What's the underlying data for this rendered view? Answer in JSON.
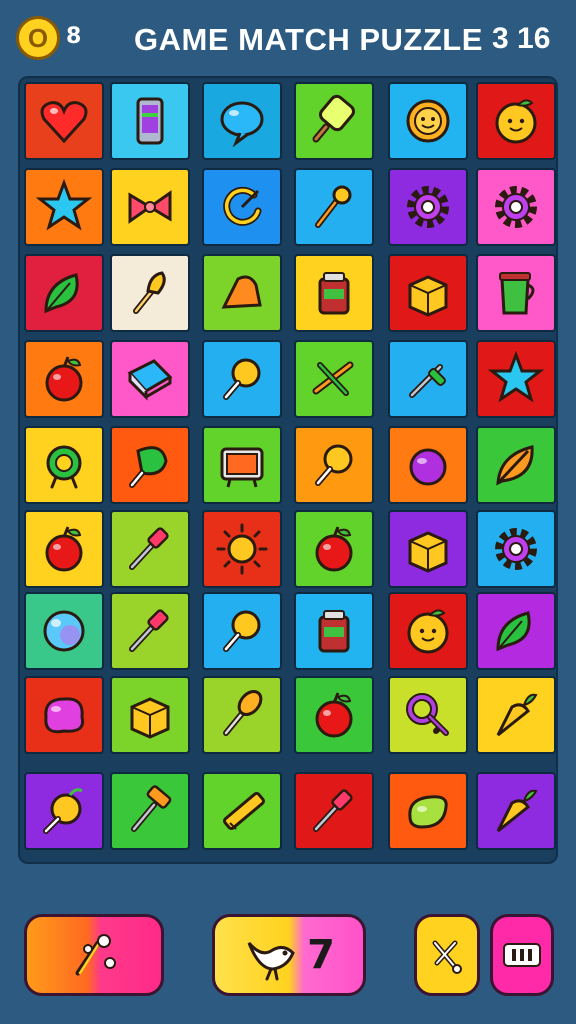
{
  "header": {
    "coin_symbol": "O",
    "coin_count": "8",
    "title": "GAME MATCH PUZZLE",
    "level": "3 16"
  },
  "board": {
    "rows": [
      [
        {
          "icon": "heart-icon",
          "bg": "#e8401c"
        },
        {
          "icon": "phone-icon",
          "bg": "#3ac8f0"
        },
        {
          "icon": "speech-bubble-icon",
          "bg": "#19a8e0"
        },
        {
          "icon": "popsicle-icon",
          "bg": "#62d32a"
        },
        {
          "icon": "sun-face-icon",
          "bg": "#22b4f0"
        },
        {
          "icon": "fruit-face-icon",
          "bg": "#e01818"
        }
      ],
      [
        {
          "icon": "star-icon",
          "bg": "#ff7a10"
        },
        {
          "icon": "bow-icon",
          "bg": "#ffd21f"
        },
        {
          "icon": "swirl-icon",
          "bg": "#1e90f0"
        },
        {
          "icon": "wand-icon",
          "bg": "#24b0f0"
        },
        {
          "icon": "gear-icon",
          "bg": "#8e2ae0"
        },
        {
          "icon": "gear-icon",
          "bg": "#ff58c8"
        }
      ],
      [
        {
          "icon": "leaf-icon",
          "bg": "#e0203e"
        },
        {
          "icon": "fork-icon",
          "bg": "#f4ebd8"
        },
        {
          "icon": "bread-icon",
          "bg": "#7cd42a"
        },
        {
          "icon": "jar-icon",
          "bg": "#ffd21f"
        },
        {
          "icon": "box-icon",
          "bg": "#e01818"
        },
        {
          "icon": "cup-icon",
          "bg": "#ff58c8"
        }
      ],
      [
        {
          "icon": "apple-icon",
          "bg": "#ff7a10"
        },
        {
          "icon": "book-icon",
          "bg": "#ff58c8"
        },
        {
          "icon": "lollipop-icon",
          "bg": "#24b0f0"
        },
        {
          "icon": "scissors-icon",
          "bg": "#62d32a"
        },
        {
          "icon": "pin-icon",
          "bg": "#24b0f0"
        },
        {
          "icon": "star-icon",
          "bg": "#e01818"
        }
      ],
      [
        {
          "icon": "wreath-icon",
          "bg": "#ffd21f"
        },
        {
          "icon": "candy-icon",
          "bg": "#ff5a10"
        },
        {
          "icon": "tv-icon",
          "bg": "#62d32a"
        },
        {
          "icon": "lollipop-icon",
          "bg": "#ff9a10"
        },
        {
          "icon": "berry-icon",
          "bg": "#ff7a10"
        },
        {
          "icon": "feather-icon",
          "bg": "#3ac83a"
        }
      ],
      [
        {
          "icon": "apple-icon",
          "bg": "#ffd21f"
        },
        {
          "icon": "brush-icon",
          "bg": "#9ad42a"
        },
        {
          "icon": "sun-icon",
          "bg": "#e83018"
        },
        {
          "icon": "apple-icon",
          "bg": "#62d32a"
        },
        {
          "icon": "box-icon",
          "bg": "#8e2ae0"
        },
        {
          "icon": "gear-icon",
          "bg": "#24b0f0"
        }
      ],
      [
        {
          "icon": "bubble-icon",
          "bg": "#3ac88a"
        },
        {
          "icon": "brush-icon",
          "bg": "#9ad42a"
        },
        {
          "icon": "lollipop-icon",
          "bg": "#24b0f0"
        },
        {
          "icon": "jar-icon",
          "bg": "#22b4f0"
        },
        {
          "icon": "fruit-face-icon",
          "bg": "#e01818"
        },
        {
          "icon": "leaf-icon",
          "bg": "#b42ae0"
        }
      ],
      [
        {
          "icon": "blob-icon",
          "bg": "#e83018"
        },
        {
          "icon": "box-icon",
          "bg": "#7cd42a"
        },
        {
          "icon": "spoon-icon",
          "bg": "#9ad42a"
        },
        {
          "icon": "apple-icon",
          "bg": "#3ac83a"
        },
        {
          "icon": "key-icon",
          "bg": "#c8e02a"
        },
        {
          "icon": "carrot-icon",
          "bg": "#ffd21f"
        }
      ],
      [
        {
          "icon": "fruit-icon",
          "bg": "#8e2ae0"
        },
        {
          "icon": "hammer-icon",
          "bg": "#3ac83a"
        },
        {
          "icon": "pencil-icon",
          "bg": "#62d32a"
        },
        {
          "icon": "brush-icon",
          "bg": "#e01818"
        },
        {
          "icon": "bean-icon",
          "bg": "#ff5a10"
        },
        {
          "icon": "carrot-icon",
          "bg": "#8e2ae0"
        }
      ]
    ]
  },
  "controls": {
    "hint_icon": "wand-icon",
    "shuffle_icon": "bird-icon",
    "shuffle_count": "7",
    "undo_icon": "undo-icon",
    "pause_icon": "menu-icon"
  }
}
